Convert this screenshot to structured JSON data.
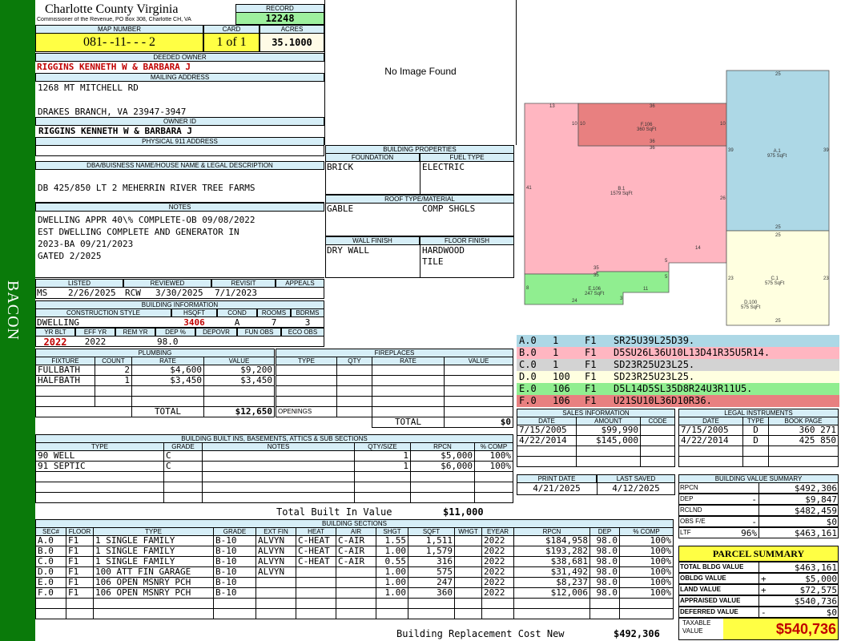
{
  "sidebar": {
    "label": "BACON"
  },
  "header": {
    "county": "Charlotte County Virginia",
    "commissioner": "Commissioner of the Revenue, PO Box 308, Charlotte CH, VA",
    "record_label": "RECORD",
    "record": "12248",
    "map_label": "MAP NUMBER",
    "map_number": "081- -11- - - 2",
    "card_label": "CARD",
    "card": "1 of 1",
    "acres_label": "ACRES",
    "acres": "35.1000"
  },
  "owner": {
    "deeded_label": "DEEDED OWNER",
    "deeded": "RIGGINS KENNETH W & BARBARA J",
    "mailing_label": "MAILING ADDRESS",
    "addr1": "1268 MT MITCHELL RD",
    "addr2": "DRAKES BRANCH, VA 23947-3947",
    "owner_id_label": "OWNER ID",
    "owner_id": "RIGGINS KENNETH W & BARBARA J",
    "physical_label": "PHYSICAL 911 ADDRESS",
    "physical": ""
  },
  "legal": {
    "label": "DBA/BUISNESS NAME/HOUSE NAME & LEGAL DESCRIPTION",
    "text": "DB 425/850 LT 2 MEHERRIN RIVER TREE FARMS"
  },
  "notes": {
    "label": "NOTES",
    "lines": [
      "DWELLING APPR 40\\% COMPLETE-OB 09/08/2022",
      "EST DWELLING COMPLETE AND GENERATOR IN",
      "2023-BA 09/21/2023",
      "GATED 2/2025"
    ]
  },
  "dates": {
    "listed_label": "LISTED",
    "listed_by": "MS",
    "listed": "2/26/2025",
    "reviewed_label": "REVIEWED",
    "reviewed_by": "RCW",
    "reviewed": "3/30/2025",
    "revisit_label": "REVISIT",
    "revisit": "7/1/2023",
    "appeals_label": "APPEALS",
    "appeals": ""
  },
  "building_info": {
    "label": "BUILDING INFORMATION",
    "style_label": "CONSTRUCTION STYLE",
    "hsqft_label": "HSQFT",
    "cond_label": "COND",
    "rooms_label": "ROOMS",
    "bdrms_label": "BDRMS",
    "style": "DWELLING",
    "hsqft": "3406",
    "cond": "A",
    "rooms": "7",
    "bdrms": "3",
    "yrblt_label": "YR BLT",
    "effyr_label": "EFF YR",
    "remyr_label": "REM YR",
    "dep_label": "DEP %",
    "depovr_label": "DEPOVR",
    "funobs_label": "FUN OBS",
    "ecoobs_label": "ECO OBS",
    "yrblt": "2022",
    "effyr": "2022",
    "remyr": "",
    "dep": "98.0",
    "depovr": "",
    "funobs": "",
    "ecoobs": ""
  },
  "image": {
    "placeholder": "No Image Found"
  },
  "building_props": {
    "label": "BUILDING PROPERTIES",
    "foundation_label": "FOUNDATION",
    "fuel_label": "FUEL TYPE",
    "foundation": "BRICK",
    "fuel": "ELECTRIC",
    "roof_label": "ROOF TYPE/MATERIAL",
    "roof_type": "GABLE",
    "roof_material": "COMP SHGLS",
    "wall_label": "WALL FINISH",
    "floor_label": "FLOOR FINISH",
    "wall": "DRY WALL",
    "floor1": "HARDWOOD",
    "floor2": "TILE"
  },
  "plumbing": {
    "label": "PLUMBING",
    "headers": [
      "FIXTURE",
      "COUNT",
      "RATE",
      "VALUE"
    ],
    "rows": [
      [
        "FULLBATH",
        "2",
        "$4,600",
        "$9,200"
      ],
      [
        "HALFBATH",
        "1",
        "$3,450",
        "$3,450"
      ]
    ],
    "total_label": "TOTAL",
    "total": "$12,650"
  },
  "fireplaces": {
    "label": "FIREPLACES",
    "headers": [
      "TYPE",
      "QTY",
      "RATE",
      "VALUE"
    ],
    "openings_label": "OPENINGS",
    "total_label": "TOTAL",
    "total": "$0"
  },
  "builtins": {
    "label": "BUILDING BUILT INS, BASEMENTS, ATTICS & SUB SECTIONS",
    "headers": [
      "TYPE",
      "GRADE",
      "NOTES",
      "QTY/SIZE",
      "RPCN",
      "% COMP"
    ],
    "rows": [
      [
        "90 WELL",
        "C",
        "",
        "1",
        "$5,000",
        "100%"
      ],
      [
        "91 SEPTIC",
        "C",
        "",
        "1",
        "$6,000",
        "100%"
      ]
    ],
    "total_label": "Total Built In Value",
    "total": "$11,000"
  },
  "sketch": {
    "labels": [
      {
        "id": "F.106",
        "area": "360 SqFt"
      },
      {
        "id": "A.1",
        "area": "975 SqFt"
      },
      {
        "id": "B.1",
        "area": "1579 SqFt"
      },
      {
        "id": "C.1",
        "area": "575 SqFt"
      },
      {
        "id": "D.100",
        "area": "575 SqFt"
      },
      {
        "id": "E.106",
        "area": "247 SqFt"
      }
    ],
    "dims": [
      "13",
      "36",
      "10",
      "10",
      "10",
      "36",
      "36",
      "25",
      "39",
      "39",
      "41",
      "26",
      "25",
      "25",
      "14",
      "35",
      "35",
      "5",
      "8",
      "11",
      "24",
      "3",
      "23",
      "23",
      "25",
      "5"
    ]
  },
  "segments": [
    {
      "code": "A.0",
      "qty": "1",
      "floor": "F1",
      "desc": "SR25U39L25D39.",
      "color": "#add8e6"
    },
    {
      "code": "B.0",
      "qty": "1",
      "floor": "F1",
      "desc": "D5SU26L36U10L13D41R35U5R14.",
      "color": "#ffb6c1"
    },
    {
      "code": "C.0",
      "qty": "1",
      "floor": "F1",
      "desc": "SD23R25U23L25.",
      "color": "#d3d3d3"
    },
    {
      "code": "D.0",
      "qty": "100",
      "floor": "F1",
      "desc": "SD23R25U23L25.",
      "color": "#ffffe0"
    },
    {
      "code": "E.0",
      "qty": "106",
      "floor": "F1",
      "desc": "D5L14D5SL35D8R24U3R11U5.",
      "color": "#90ee90"
    },
    {
      "code": "F.0",
      "qty": "106",
      "floor": "F1",
      "desc": "U21SU10L36D10R36.",
      "color": "#e88080"
    }
  ],
  "sales": {
    "label": "SALES INFORMATION",
    "headers": [
      "DATE",
      "AMOUNT",
      "CODE"
    ],
    "rows": [
      [
        "7/15/2005",
        "$99,990",
        ""
      ],
      [
        "4/22/2014",
        "$145,000",
        ""
      ]
    ]
  },
  "legal_instruments": {
    "label": "LEGAL INSTRUMENTS",
    "headers": [
      "DATE",
      "TYPE",
      "BOOK PAGE"
    ],
    "rows": [
      [
        "7/15/2005",
        "D",
        "360 271"
      ],
      [
        "4/22/2014",
        "D",
        "425 850"
      ]
    ]
  },
  "print": {
    "print_label": "PRINT DATE",
    "saved_label": "LAST SAVED",
    "print_date": "4/21/2025",
    "saved_date": "4/12/2025"
  },
  "value_summary": {
    "label": "BUILDING VALUE SUMMARY",
    "rows": [
      {
        "k": "RPCN",
        "s": "",
        "v": "$492,306"
      },
      {
        "k": "DEP",
        "s": "-",
        "v": "$9,847"
      },
      {
        "k": "RCLND",
        "s": "",
        "v": "$482,459"
      },
      {
        "k": "OBS F/E",
        "s": "-",
        "v": "$0"
      },
      {
        "k": "LTF",
        "s": "96%",
        "v": "$463,161"
      }
    ]
  },
  "parcel": {
    "label": "PARCEL SUMMARY",
    "rows": [
      {
        "k": "TOTAL BLDG VALUE",
        "s": "",
        "v": "$463,161"
      },
      {
        "k": "OBLDG VALUE",
        "s": "+",
        "v": "$5,000"
      },
      {
        "k": "LAND VALUE",
        "s": "+",
        "v": "$72,575"
      },
      {
        "k": "APPRAISED VALUE",
        "s": "",
        "v": "$540,736"
      },
      {
        "k": "DEFERRED VALUE",
        "s": "-",
        "v": "$0"
      }
    ],
    "taxable_label1": "TAXABLE",
    "taxable_label2": "VALUE",
    "taxable": "$540,736"
  },
  "sections": {
    "label": "BUILDING SECTIONS",
    "headers": [
      "SEC#",
      "FLOOR",
      "TYPE",
      "GRADE",
      "EXT FIN",
      "HEAT",
      "AIR",
      "SHGT",
      "SQFT",
      "WHGT",
      "EYEAR",
      "RPCN",
      "DEP",
      "% COMP"
    ],
    "rows": [
      [
        "A.0",
        "F1",
        "1 SINGLE FAMILY",
        "B-10",
        "ALVYN",
        "C-HEAT",
        "C-AIR",
        "1.55",
        "1,511",
        "",
        "2022",
        "$184,958",
        "98.0",
        "100%"
      ],
      [
        "B.0",
        "F1",
        "1 SINGLE FAMILY",
        "B-10",
        "ALVYN",
        "C-HEAT",
        "C-AIR",
        "1.00",
        "1,579",
        "",
        "2022",
        "$193,282",
        "98.0",
        "100%"
      ],
      [
        "C.0",
        "F1",
        "1 SINGLE FAMILY",
        "B-10",
        "ALVYN",
        "C-HEAT",
        "C-AIR",
        "0.55",
        "316",
        "",
        "2022",
        "$38,681",
        "98.0",
        "100%"
      ],
      [
        "D.0",
        "F1",
        "100 ATT FIN GARAGE",
        "B-10",
        "ALVYN",
        "",
        "",
        "1.00",
        "575",
        "",
        "2022",
        "$31,492",
        "98.0",
        "100%"
      ],
      [
        "E.0",
        "F1",
        "106 OPEN MSNRY PCH",
        "B-10",
        "",
        "",
        "",
        "1.00",
        "247",
        "",
        "2022",
        "$8,237",
        "98.0",
        "100%"
      ],
      [
        "F.0",
        "F1",
        "106 OPEN MSNRY PCH",
        "B-10",
        "",
        "",
        "",
        "1.00",
        "360",
        "",
        "2022",
        "$12,006",
        "98.0",
        "100%"
      ]
    ],
    "total_label": "Building Replacement Cost New",
    "total": "$492,306"
  }
}
